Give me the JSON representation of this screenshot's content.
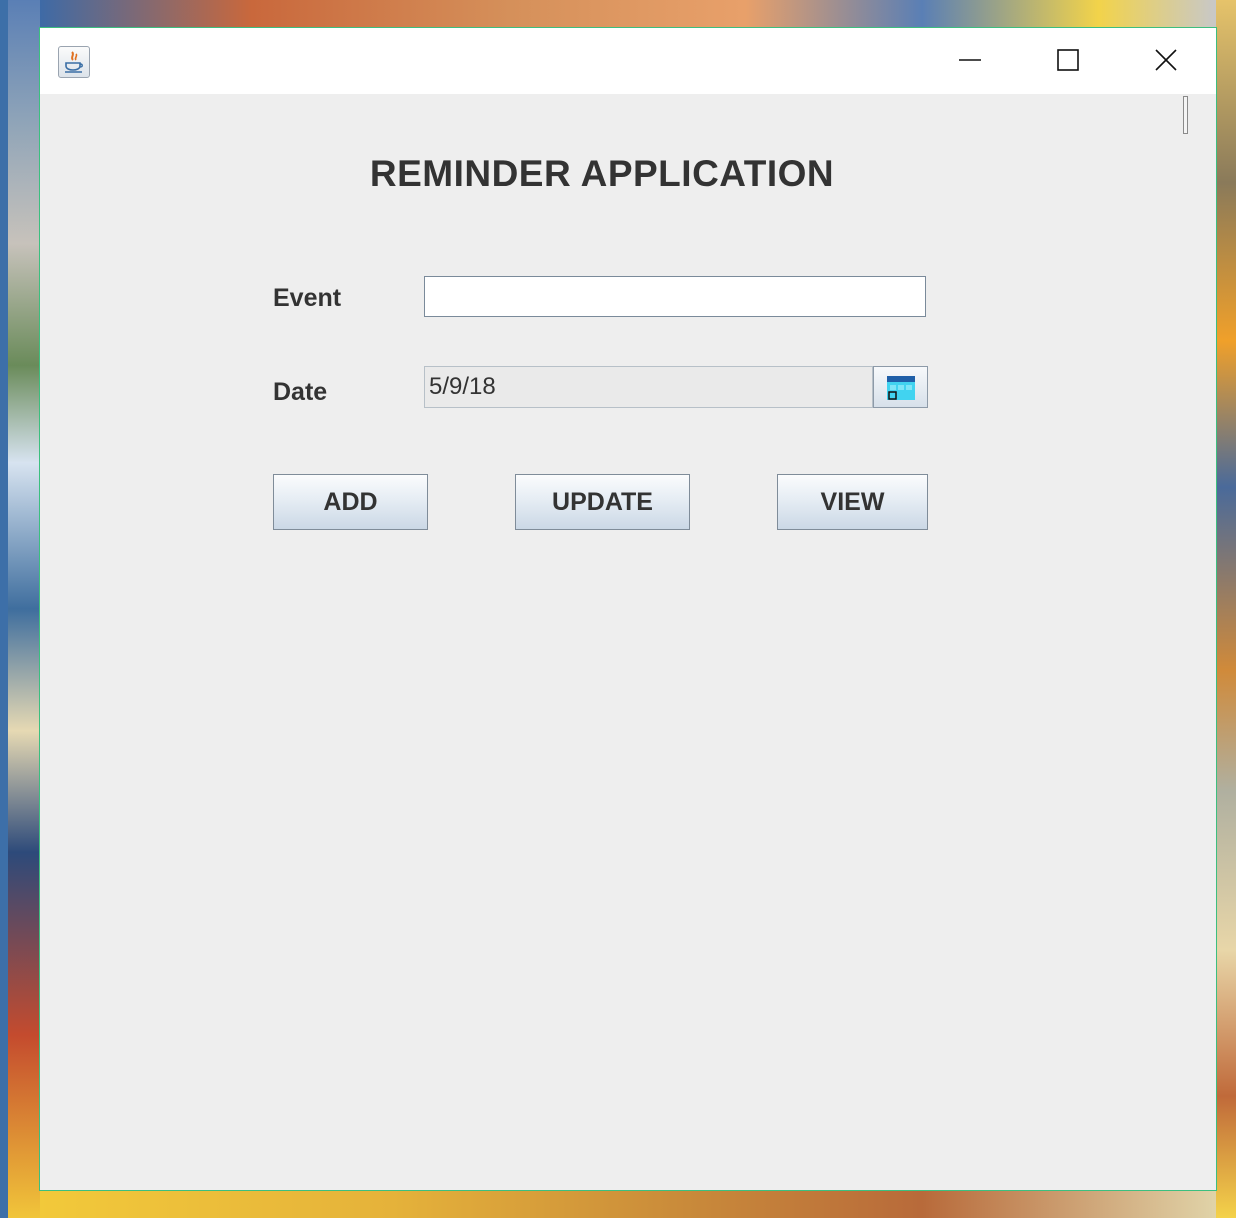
{
  "window": {
    "icon": "java-icon",
    "controls": {
      "minimize": "minimize-icon",
      "maximize": "maximize-icon",
      "close": "close-icon"
    },
    "accent_border": "#3cbf7f"
  },
  "main": {
    "title": "REMINDER APPLICATION",
    "event": {
      "label": "Event",
      "value": ""
    },
    "date": {
      "label": "Date",
      "value": "5/9/18",
      "picker_icon": "calendar-icon"
    },
    "buttons": {
      "add": "ADD",
      "update": "UPDATE",
      "view": "VIEW"
    }
  }
}
